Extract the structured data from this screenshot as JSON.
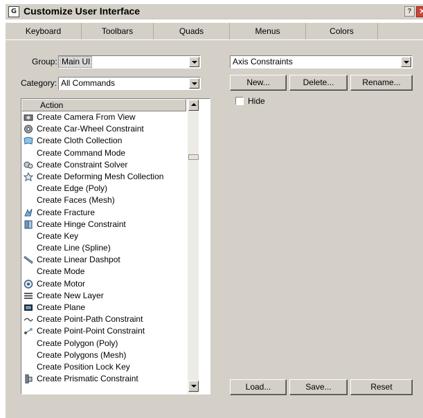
{
  "window": {
    "title": "Customize User Interface",
    "title_icon": "G",
    "help_glyph": "?",
    "close_glyph": "✕"
  },
  "tabs": [
    {
      "label": "Keyboard"
    },
    {
      "label": "Toolbars",
      "active": true
    },
    {
      "label": "Quads"
    },
    {
      "label": "Menus"
    },
    {
      "label": "Colors"
    }
  ],
  "left": {
    "group_label": "Group:",
    "group_value": "Main UI",
    "category_label": "Category:",
    "category_value": "All Commands",
    "list_header": "Action",
    "actions": [
      {
        "label": "Create Camera From View",
        "icon": "camera-icon"
      },
      {
        "label": "Create Car-Wheel Constraint",
        "icon": "wheel-icon"
      },
      {
        "label": "Create Cloth Collection",
        "icon": "cloth-icon"
      },
      {
        "label": "Create Command Mode",
        "icon": ""
      },
      {
        "label": "Create Constraint Solver",
        "icon": "solver-icon"
      },
      {
        "label": "Create Deforming Mesh Collection",
        "icon": "deforming-mesh-icon"
      },
      {
        "label": "Create Edge (Poly)",
        "icon": ""
      },
      {
        "label": "Create Faces (Mesh)",
        "icon": ""
      },
      {
        "label": "Create Fracture",
        "icon": "fracture-icon"
      },
      {
        "label": "Create Hinge Constraint",
        "icon": "hinge-icon"
      },
      {
        "label": "Create Key",
        "icon": ""
      },
      {
        "label": "Create Line (Spline)",
        "icon": ""
      },
      {
        "label": "Create Linear Dashpot",
        "icon": "dashpot-icon"
      },
      {
        "label": "Create Mode",
        "icon": ""
      },
      {
        "label": "Create Motor",
        "icon": "motor-icon"
      },
      {
        "label": "Create New Layer",
        "icon": "layer-icon"
      },
      {
        "label": "Create Plane",
        "icon": "plane-icon"
      },
      {
        "label": "Create Point-Path Constraint",
        "icon": "point-path-icon"
      },
      {
        "label": "Create Point-Point Constraint",
        "icon": "point-point-icon"
      },
      {
        "label": "Create Polygon (Poly)",
        "icon": ""
      },
      {
        "label": "Create Polygons (Mesh)",
        "icon": ""
      },
      {
        "label": "Create Position Lock Key",
        "icon": ""
      },
      {
        "label": "Create Prismatic Constraint",
        "icon": "prismatic-icon"
      }
    ]
  },
  "right": {
    "toolbar_value": "Axis Constraints",
    "new_label": "New...",
    "delete_label": "Delete...",
    "rename_label": "Rename...",
    "hide_label": "Hide",
    "load_label": "Load...",
    "save_label": "Save...",
    "reset_label": "Reset"
  }
}
